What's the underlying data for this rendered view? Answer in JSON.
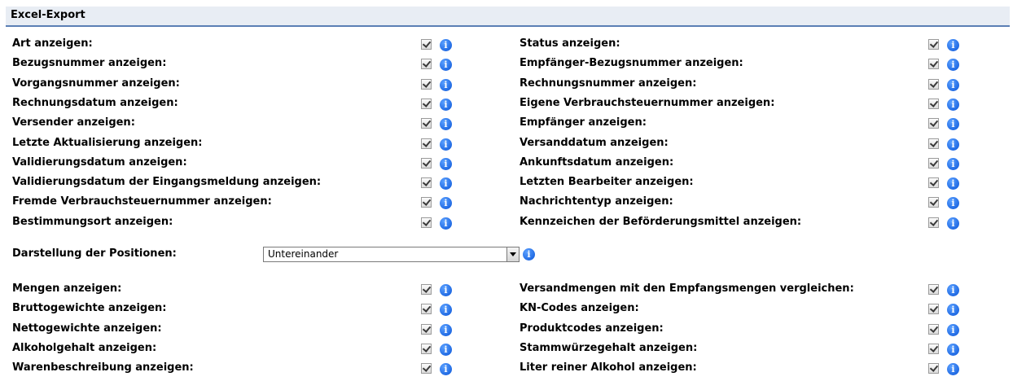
{
  "section": {
    "title": "Excel-Export"
  },
  "left_group1": [
    {
      "label": "Art anzeigen:",
      "checked": true
    },
    {
      "label": "Bezugsnummer anzeigen:",
      "checked": true
    },
    {
      "label": "Vorgangsnummer anzeigen:",
      "checked": true
    },
    {
      "label": "Rechnungsdatum anzeigen:",
      "checked": true
    },
    {
      "label": "Versender anzeigen:",
      "checked": true
    },
    {
      "label": "Letzte Aktualisierung anzeigen:",
      "checked": true
    },
    {
      "label": "Validierungsdatum anzeigen:",
      "checked": true
    },
    {
      "label": "Validierungsdatum der Eingangsmeldung anzeigen:",
      "checked": true
    },
    {
      "label": "Fremde Verbrauchsteuernummer anzeigen:",
      "checked": true
    },
    {
      "label": "Bestimmungsort anzeigen:",
      "checked": true
    }
  ],
  "right_group1": [
    {
      "label": "Status anzeigen:",
      "checked": true
    },
    {
      "label": "Empfänger-Bezugsnummer anzeigen:",
      "checked": true
    },
    {
      "label": "Rechnungsnummer anzeigen:",
      "checked": true
    },
    {
      "label": "Eigene Verbrauchsteuernummer anzeigen:",
      "checked": true
    },
    {
      "label": "Empfänger anzeigen:",
      "checked": true
    },
    {
      "label": "Versanddatum anzeigen:",
      "checked": true
    },
    {
      "label": "Ankunftsdatum anzeigen:",
      "checked": true
    },
    {
      "label": "Letzten Bearbeiter anzeigen:",
      "checked": true
    },
    {
      "label": "Nachrichtentyp anzeigen:",
      "checked": true
    },
    {
      "label": "Kennzeichen der Beförderungsmittel anzeigen:",
      "checked": true
    }
  ],
  "position_display": {
    "label": "Darstellung der Positionen:",
    "selected": "Untereinander"
  },
  "left_group2": [
    {
      "label": "Mengen anzeigen:",
      "checked": true
    },
    {
      "label": "Bruttogewichte anzeigen:",
      "checked": true
    },
    {
      "label": "Nettogewichte anzeigen:",
      "checked": true
    },
    {
      "label": "Alkoholgehalt anzeigen:",
      "checked": true
    },
    {
      "label": "Warenbeschreibung anzeigen:",
      "checked": true
    }
  ],
  "right_group2": [
    {
      "label": "Versandmengen mit den Empfangsmengen vergleichen:",
      "checked": true
    },
    {
      "label": "KN-Codes anzeigen:",
      "checked": true
    },
    {
      "label": "Produktcodes anzeigen:",
      "checked": true
    },
    {
      "label": "Stammwürzegehalt anzeigen:",
      "checked": true
    },
    {
      "label": "Liter reiner Alkohol anzeigen:",
      "checked": true
    }
  ],
  "info_icon_glyph": "i",
  "colors": {
    "header_bg": "#e8edf4",
    "header_line": "#5b7fb5",
    "info_blue": "#0a55d8"
  }
}
